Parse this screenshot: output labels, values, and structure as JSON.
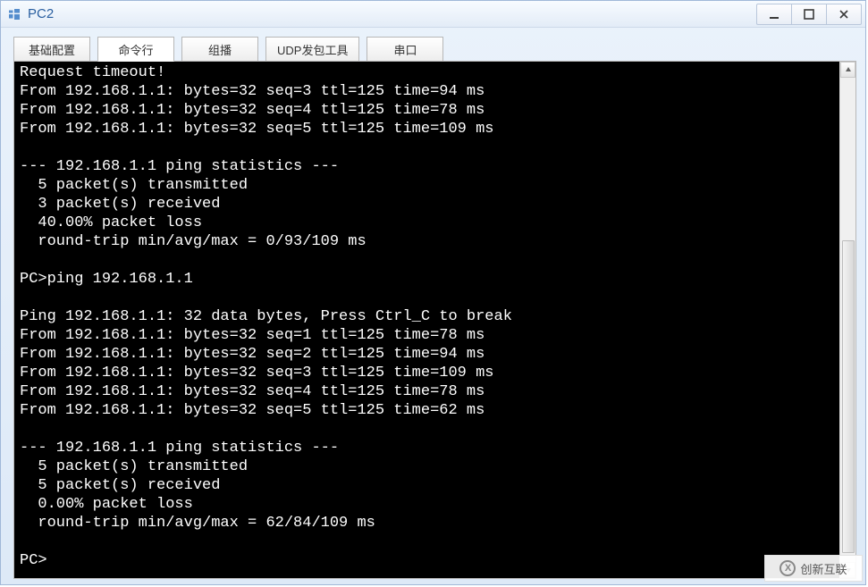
{
  "window": {
    "title": "PC2"
  },
  "tabs": [
    {
      "label": "基础配置",
      "active": false
    },
    {
      "label": "命令行",
      "active": true
    },
    {
      "label": "组播",
      "active": false
    },
    {
      "label": "UDP发包工具",
      "active": false
    },
    {
      "label": "串口",
      "active": false
    }
  ],
  "terminal_lines": [
    "Request timeout!",
    "From 192.168.1.1: bytes=32 seq=3 ttl=125 time=94 ms",
    "From 192.168.1.1: bytes=32 seq=4 ttl=125 time=78 ms",
    "From 192.168.1.1: bytes=32 seq=5 ttl=125 time=109 ms",
    "",
    "--- 192.168.1.1 ping statistics ---",
    "  5 packet(s) transmitted",
    "  3 packet(s) received",
    "  40.00% packet loss",
    "  round-trip min/avg/max = 0/93/109 ms",
    "",
    "PC>ping 192.168.1.1",
    "",
    "Ping 192.168.1.1: 32 data bytes, Press Ctrl_C to break",
    "From 192.168.1.1: bytes=32 seq=1 ttl=125 time=78 ms",
    "From 192.168.1.1: bytes=32 seq=2 ttl=125 time=94 ms",
    "From 192.168.1.1: bytes=32 seq=3 ttl=125 time=109 ms",
    "From 192.168.1.1: bytes=32 seq=4 ttl=125 time=78 ms",
    "From 192.168.1.1: bytes=32 seq=5 ttl=125 time=62 ms",
    "",
    "--- 192.168.1.1 ping statistics ---",
    "  5 packet(s) transmitted",
    "  5 packet(s) received",
    "  0.00% packet loss",
    "  round-trip min/avg/max = 62/84/109 ms",
    "",
    "PC>"
  ],
  "watermark": {
    "text": "创新互联"
  }
}
